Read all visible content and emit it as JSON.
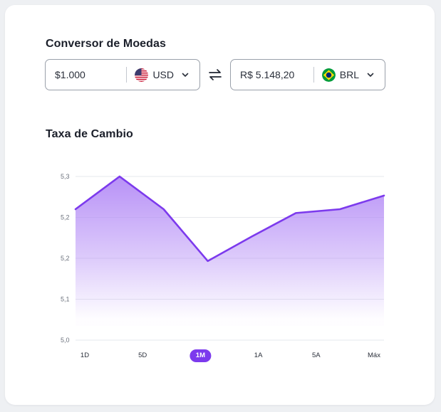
{
  "converter": {
    "title": "Conversor de Moedas",
    "from": {
      "amount": "$1.000",
      "currency": "USD",
      "flag_icon": "us-flag-icon"
    },
    "to": {
      "amount": "R$ 5.148,20",
      "currency": "BRL",
      "flag_icon": "brazil-flag-icon"
    },
    "swap_icon": "swap-arrows-icon"
  },
  "rate": {
    "title": "Taxa de Cambio",
    "ranges": [
      "1D",
      "5D",
      "1M",
      "1A",
      "5A",
      "Máx"
    ],
    "active_range": "1M"
  },
  "colors": {
    "accent": "#7c3aed",
    "line": "#7c3aed",
    "fill_top": "#b48cf6",
    "grid": "#e6e8ec"
  },
  "chart_data": {
    "type": "area",
    "x": [
      0,
      1,
      2,
      3,
      4,
      5,
      6,
      7
    ],
    "values": [
      5.24,
      5.3,
      5.24,
      5.145,
      5.19,
      5.233,
      5.24,
      5.265
    ],
    "y_tick_labels": [
      "5,3",
      "5,2",
      "5,2",
      "5,1",
      "5,0"
    ],
    "ylim": [
      5.0,
      5.3
    ],
    "grid": true,
    "title": "",
    "xlabel": "",
    "ylabel": ""
  }
}
